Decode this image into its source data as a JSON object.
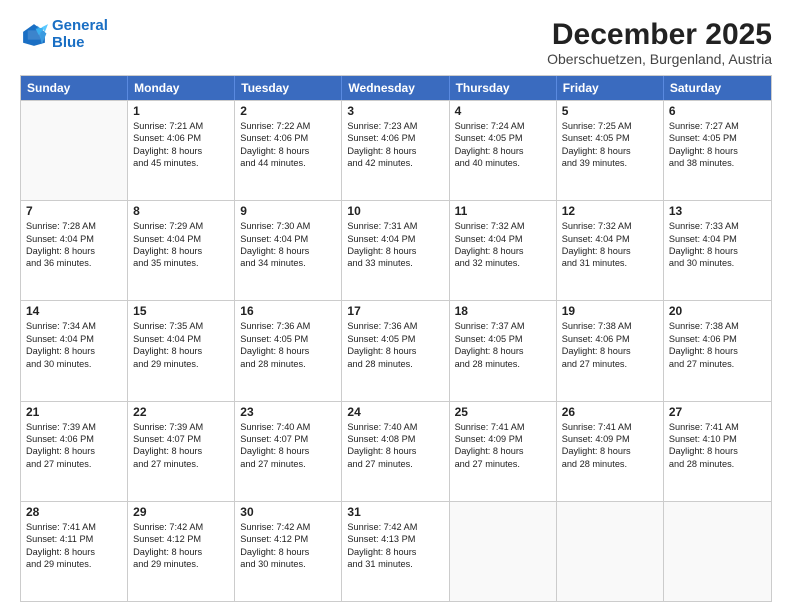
{
  "logo": {
    "line1": "General",
    "line2": "Blue"
  },
  "title": "December 2025",
  "subtitle": "Oberschuetzen, Burgenland, Austria",
  "header_days": [
    "Sunday",
    "Monday",
    "Tuesday",
    "Wednesday",
    "Thursday",
    "Friday",
    "Saturday"
  ],
  "weeks": [
    [
      {
        "day": "",
        "text": ""
      },
      {
        "day": "1",
        "text": "Sunrise: 7:21 AM\nSunset: 4:06 PM\nDaylight: 8 hours\nand 45 minutes."
      },
      {
        "day": "2",
        "text": "Sunrise: 7:22 AM\nSunset: 4:06 PM\nDaylight: 8 hours\nand 44 minutes."
      },
      {
        "day": "3",
        "text": "Sunrise: 7:23 AM\nSunset: 4:06 PM\nDaylight: 8 hours\nand 42 minutes."
      },
      {
        "day": "4",
        "text": "Sunrise: 7:24 AM\nSunset: 4:05 PM\nDaylight: 8 hours\nand 40 minutes."
      },
      {
        "day": "5",
        "text": "Sunrise: 7:25 AM\nSunset: 4:05 PM\nDaylight: 8 hours\nand 39 minutes."
      },
      {
        "day": "6",
        "text": "Sunrise: 7:27 AM\nSunset: 4:05 PM\nDaylight: 8 hours\nand 38 minutes."
      }
    ],
    [
      {
        "day": "7",
        "text": "Sunrise: 7:28 AM\nSunset: 4:04 PM\nDaylight: 8 hours\nand 36 minutes."
      },
      {
        "day": "8",
        "text": "Sunrise: 7:29 AM\nSunset: 4:04 PM\nDaylight: 8 hours\nand 35 minutes."
      },
      {
        "day": "9",
        "text": "Sunrise: 7:30 AM\nSunset: 4:04 PM\nDaylight: 8 hours\nand 34 minutes."
      },
      {
        "day": "10",
        "text": "Sunrise: 7:31 AM\nSunset: 4:04 PM\nDaylight: 8 hours\nand 33 minutes."
      },
      {
        "day": "11",
        "text": "Sunrise: 7:32 AM\nSunset: 4:04 PM\nDaylight: 8 hours\nand 32 minutes."
      },
      {
        "day": "12",
        "text": "Sunrise: 7:32 AM\nSunset: 4:04 PM\nDaylight: 8 hours\nand 31 minutes."
      },
      {
        "day": "13",
        "text": "Sunrise: 7:33 AM\nSunset: 4:04 PM\nDaylight: 8 hours\nand 30 minutes."
      }
    ],
    [
      {
        "day": "14",
        "text": "Sunrise: 7:34 AM\nSunset: 4:04 PM\nDaylight: 8 hours\nand 30 minutes."
      },
      {
        "day": "15",
        "text": "Sunrise: 7:35 AM\nSunset: 4:04 PM\nDaylight: 8 hours\nand 29 minutes."
      },
      {
        "day": "16",
        "text": "Sunrise: 7:36 AM\nSunset: 4:05 PM\nDaylight: 8 hours\nand 28 minutes."
      },
      {
        "day": "17",
        "text": "Sunrise: 7:36 AM\nSunset: 4:05 PM\nDaylight: 8 hours\nand 28 minutes."
      },
      {
        "day": "18",
        "text": "Sunrise: 7:37 AM\nSunset: 4:05 PM\nDaylight: 8 hours\nand 28 minutes."
      },
      {
        "day": "19",
        "text": "Sunrise: 7:38 AM\nSunset: 4:06 PM\nDaylight: 8 hours\nand 27 minutes."
      },
      {
        "day": "20",
        "text": "Sunrise: 7:38 AM\nSunset: 4:06 PM\nDaylight: 8 hours\nand 27 minutes."
      }
    ],
    [
      {
        "day": "21",
        "text": "Sunrise: 7:39 AM\nSunset: 4:06 PM\nDaylight: 8 hours\nand 27 minutes."
      },
      {
        "day": "22",
        "text": "Sunrise: 7:39 AM\nSunset: 4:07 PM\nDaylight: 8 hours\nand 27 minutes."
      },
      {
        "day": "23",
        "text": "Sunrise: 7:40 AM\nSunset: 4:07 PM\nDaylight: 8 hours\nand 27 minutes."
      },
      {
        "day": "24",
        "text": "Sunrise: 7:40 AM\nSunset: 4:08 PM\nDaylight: 8 hours\nand 27 minutes."
      },
      {
        "day": "25",
        "text": "Sunrise: 7:41 AM\nSunset: 4:09 PM\nDaylight: 8 hours\nand 27 minutes."
      },
      {
        "day": "26",
        "text": "Sunrise: 7:41 AM\nSunset: 4:09 PM\nDaylight: 8 hours\nand 28 minutes."
      },
      {
        "day": "27",
        "text": "Sunrise: 7:41 AM\nSunset: 4:10 PM\nDaylight: 8 hours\nand 28 minutes."
      }
    ],
    [
      {
        "day": "28",
        "text": "Sunrise: 7:41 AM\nSunset: 4:11 PM\nDaylight: 8 hours\nand 29 minutes."
      },
      {
        "day": "29",
        "text": "Sunrise: 7:42 AM\nSunset: 4:12 PM\nDaylight: 8 hours\nand 29 minutes."
      },
      {
        "day": "30",
        "text": "Sunrise: 7:42 AM\nSunset: 4:12 PM\nDaylight: 8 hours\nand 30 minutes."
      },
      {
        "day": "31",
        "text": "Sunrise: 7:42 AM\nSunset: 4:13 PM\nDaylight: 8 hours\nand 31 minutes."
      },
      {
        "day": "",
        "text": ""
      },
      {
        "day": "",
        "text": ""
      },
      {
        "day": "",
        "text": ""
      }
    ]
  ]
}
